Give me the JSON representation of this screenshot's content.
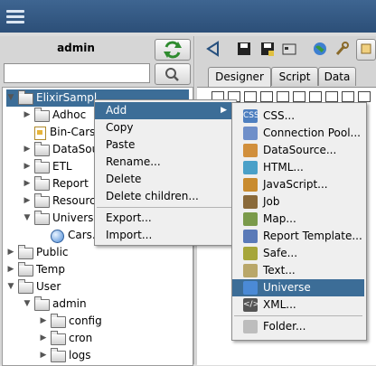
{
  "app": {
    "menu_icon": "hamburger-icon"
  },
  "sidebar": {
    "user": "admin",
    "refresh_icon": "refresh-icon",
    "search_placeholder": "",
    "search_icon": "search-icon",
    "tree": [
      {
        "label": "ElixirSampl",
        "toggle": "▼",
        "icon": "folder",
        "selected": true
      },
      {
        "label": "Adhoc",
        "toggle": "▶",
        "icon": "folder"
      },
      {
        "label": "Bin-Cars",
        "toggle": "",
        "icon": "doc"
      },
      {
        "label": "DataSou",
        "toggle": "▶",
        "icon": "folder"
      },
      {
        "label": "ETL",
        "toggle": "▶",
        "icon": "folder"
      },
      {
        "label": "Report",
        "toggle": "▶",
        "icon": "folder"
      },
      {
        "label": "Resourc",
        "toggle": "▶",
        "icon": "folder"
      },
      {
        "label": "Univers",
        "toggle": "▼",
        "icon": "folder"
      },
      {
        "label": "Cars.",
        "toggle": "",
        "icon": "globe"
      },
      {
        "label": "Public",
        "toggle": "▶",
        "icon": "folder"
      },
      {
        "label": "Temp",
        "toggle": "▶",
        "icon": "folder"
      },
      {
        "label": "User",
        "toggle": "▼",
        "icon": "folder"
      },
      {
        "label": "admin",
        "toggle": "▼",
        "icon": "folder"
      },
      {
        "label": "config",
        "toggle": "▶",
        "icon": "folder"
      },
      {
        "label": "cron",
        "toggle": "▶",
        "icon": "folder"
      },
      {
        "label": "logs",
        "toggle": "▶",
        "icon": "folder"
      }
    ]
  },
  "editor": {
    "tabs": [
      {
        "label": "Designer",
        "active": true
      },
      {
        "label": "Script",
        "active": false
      },
      {
        "label": "Data",
        "active": false
      }
    ],
    "toolbar_icons": [
      "back-arrow-icon",
      "save-icon",
      "save-as-icon",
      "properties-icon",
      "globe-icon",
      "wrench-icon",
      "tool-icon"
    ]
  },
  "context_menu": {
    "items": [
      {
        "label": "Add",
        "has_submenu": true,
        "submenu_arrow": "▶",
        "highlighted": true
      },
      {
        "label": "Copy"
      },
      {
        "label": "Paste"
      },
      {
        "label": "Rename..."
      },
      {
        "label": "Delete"
      },
      {
        "label": "Delete children..."
      },
      {
        "separator": true
      },
      {
        "label": "Export..."
      },
      {
        "label": "Import..."
      }
    ]
  },
  "add_submenu": {
    "items": [
      {
        "label": "CSS...",
        "icon": "css-icon",
        "icon_text": "CSS",
        "color": "#4e7fbf"
      },
      {
        "label": "Connection Pool...",
        "icon": "connection-pool-icon",
        "icon_text": "",
        "color": "#6f8fc9"
      },
      {
        "label": "DataSource...",
        "icon": "datasource-icon",
        "icon_text": "",
        "color": "#d18f3c"
      },
      {
        "label": "HTML...",
        "icon": "html-icon",
        "icon_text": "",
        "color": "#4aa0c8"
      },
      {
        "label": "JavaScript...",
        "icon": "javascript-icon",
        "icon_text": "",
        "color": "#c98b2e"
      },
      {
        "label": "Job",
        "icon": "job-icon",
        "icon_text": "",
        "color": "#8a6a3a"
      },
      {
        "label": "Map...",
        "icon": "map-icon",
        "icon_text": "",
        "color": "#7a9a4a"
      },
      {
        "label": "Report Template...",
        "icon": "report-template-icon",
        "icon_text": "",
        "color": "#5a7ab8"
      },
      {
        "label": "Safe...",
        "icon": "safe-icon",
        "icon_text": "",
        "color": "#a6a63a"
      },
      {
        "label": "Text...",
        "icon": "text-icon",
        "icon_text": "",
        "color": "#b9a76a"
      },
      {
        "label": "Universe",
        "icon": "universe-icon",
        "icon_text": "",
        "color": "#4b8ad6",
        "highlighted": true
      },
      {
        "label": "XML...",
        "icon": "xml-icon",
        "icon_text": "</>",
        "color": "#555555"
      },
      {
        "separator": true
      },
      {
        "label": "Folder...",
        "icon": "folder-icon",
        "icon_text": "",
        "color": "#bdbdbd"
      }
    ]
  }
}
